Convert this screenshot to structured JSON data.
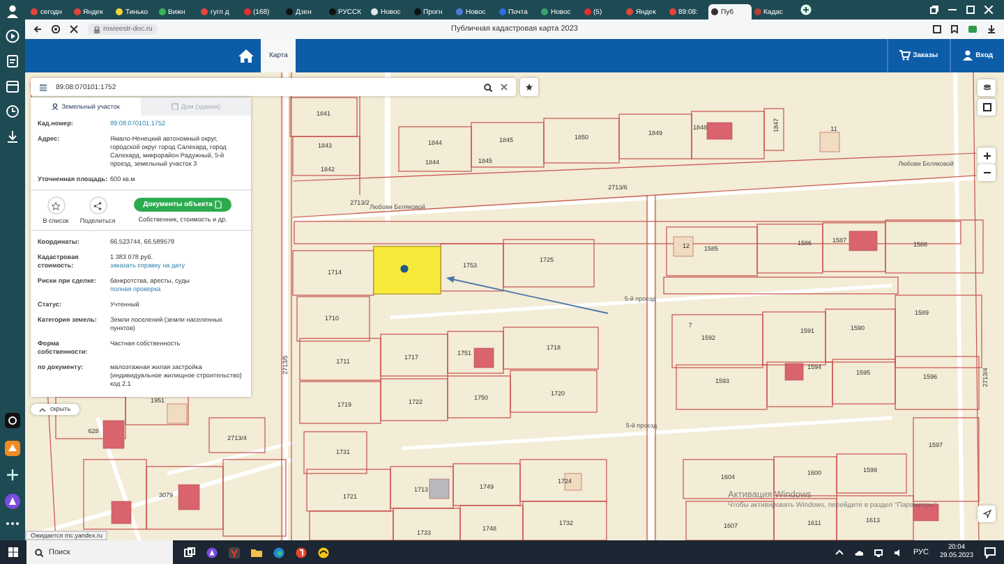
{
  "browser": {
    "tabs": [
      {
        "title": "сегодн",
        "color": "#e4453a",
        "selected": false
      },
      {
        "title": "Яндек",
        "color": "#e4453a",
        "selected": false
      },
      {
        "title": "Тинько",
        "color": "#f5d33c",
        "selected": false
      },
      {
        "title": "Вижн",
        "color": "#3bb35a",
        "selected": false
      },
      {
        "title": "гугл д",
        "color": "#e4453a",
        "selected": false
      },
      {
        "title": "(168)",
        "color": "#e03030",
        "selected": false
      },
      {
        "title": "Дзен",
        "color": "#111111",
        "selected": false
      },
      {
        "title": "РУССК",
        "color": "#111111",
        "selected": false
      },
      {
        "title": "Новос",
        "color": "#dfe8ea",
        "selected": false
      },
      {
        "title": "Прогн",
        "color": "#111111",
        "selected": false
      },
      {
        "title": "Новос",
        "color": "#4b7bd8",
        "selected": false
      },
      {
        "title": "Почта",
        "color": "#2f6fe0",
        "selected": false
      },
      {
        "title": "Новос",
        "color": "#3aa36a",
        "selected": false
      },
      {
        "title": "(5)",
        "color": "#e03030",
        "selected": false
      },
      {
        "title": "Яндек",
        "color": "#e4453a",
        "selected": false
      },
      {
        "title": "89:08:",
        "color": "#e4453a",
        "selected": false
      },
      {
        "title": "Пуб",
        "color": "#333333",
        "selected": true
      },
      {
        "title": "Кадас",
        "color": "#b5412e",
        "selected": false
      }
    ],
    "address": "rosreestr-doc.ru",
    "page_title": "Публичная кадастровая карта 2023",
    "status": "Ожидается mc.yandex.ru"
  },
  "site_header": {
    "nav": [
      {
        "label": "Карта",
        "selected": true
      }
    ],
    "actions": [
      "Заказы",
      "Вход"
    ]
  },
  "search": {
    "value": "89:08:070101:1752"
  },
  "panel": {
    "tabs": [
      {
        "label": "Земельный участок",
        "selected": true
      },
      {
        "label": "Дом (здания)",
        "selected": false
      }
    ],
    "fields": [
      {
        "label": "Кад.номер:",
        "value": "89:08:070101:1752",
        "kind": "link"
      },
      {
        "label": "Адрес:",
        "value": "Ямало-Ненецкий автономный округ, городской округ город Салехард, город Салехард, микрорайон Радужный, 5-й проезд, земельный участок 3",
        "kind": "text"
      },
      {
        "label": "Уточненная площадь:",
        "value": "600 кв.м",
        "kind": "text"
      }
    ],
    "actions": [
      {
        "label": "В список",
        "kind": "star"
      },
      {
        "label": "Поделиться",
        "kind": "share"
      }
    ],
    "documents_button": "Документы объекта",
    "documents_caption": "Собственник, стоимость и др.",
    "details": [
      {
        "label": "Координаты:",
        "value": "66.523744, 66.589579"
      },
      {
        "label": "Кадастровая стоимость:",
        "value": "1 383 078 руб.",
        "link": "заказать справку на дату"
      },
      {
        "label": "Риски при сделке:",
        "value": "банкротства, аресты, суды",
        "link": "полная проверка"
      },
      {
        "label": "Статус:",
        "value": "Учтенный"
      },
      {
        "label": "Категория земель:",
        "value": "Земли поселений (земли населенных пунктов)"
      },
      {
        "label": "Форма собственности:",
        "value": "Частная собственность"
      },
      {
        "label": "по документу:",
        "value": "малоэтажная жилая застройка (индивидуальное жилищное строительство) код 2.1"
      }
    ],
    "hide_button": "скрыть"
  },
  "map": {
    "labels": [
      {
        "text": "1841",
        "kind": "parcel"
      },
      {
        "text": "1843",
        "kind": "parcel"
      },
      {
        "text": "1842",
        "kind": "parcel"
      },
      {
        "text": "1844",
        "kind": "parcel"
      },
      {
        "text": "1844",
        "kind": "parcel"
      },
      {
        "text": "1845",
        "kind": "parcel"
      },
      {
        "text": "1845",
        "kind": "parcel"
      },
      {
        "text": "1850",
        "kind": "parcel"
      },
      {
        "text": "1849",
        "kind": "parcel"
      },
      {
        "text": "1848",
        "kind": "parcel"
      },
      {
        "text": "1847",
        "kind": "vertical"
      },
      {
        "text": "11",
        "kind": "parcel"
      },
      {
        "text": "2713/6",
        "kind": "parcel"
      },
      {
        "text": "2713/2",
        "kind": "parcel"
      },
      {
        "text": "Любови Беляковой",
        "kind": "street"
      },
      {
        "text": "Любови Беляковой",
        "kind": "street"
      },
      {
        "text": "2713/5",
        "kind": "vertical"
      },
      {
        "text": "1714",
        "kind": "parcel"
      },
      {
        "text": "1753",
        "kind": "parcel"
      },
      {
        "text": "1725",
        "kind": "parcel"
      },
      {
        "text": "1710",
        "kind": "parcel"
      },
      {
        "text": "5-й проезд",
        "kind": "street"
      },
      {
        "text": "1711",
        "kind": "parcel"
      },
      {
        "text": "1717",
        "kind": "parcel"
      },
      {
        "text": "1751",
        "kind": "parcel"
      },
      {
        "text": "1718",
        "kind": "parcel"
      },
      {
        "text": "1719",
        "kind": "parcel"
      },
      {
        "text": "1722",
        "kind": "parcel"
      },
      {
        "text": "1750",
        "kind": "parcel"
      },
      {
        "text": "1720",
        "kind": "parcel"
      },
      {
        "text": "1731",
        "kind": "parcel"
      },
      {
        "text": "1721",
        "kind": "parcel"
      },
      {
        "text": "1713",
        "kind": "parcel"
      },
      {
        "text": "1749",
        "kind": "parcel"
      },
      {
        "text": "1724",
        "kind": "parcel"
      },
      {
        "text": "1733",
        "kind": "parcel"
      },
      {
        "text": "1748",
        "kind": "parcel"
      },
      {
        "text": "1732",
        "kind": "parcel"
      },
      {
        "text": "12",
        "kind": "parcel"
      },
      {
        "text": "1585",
        "kind": "parcel"
      },
      {
        "text": "1586",
        "kind": "parcel"
      },
      {
        "text": "1587",
        "kind": "parcel"
      },
      {
        "text": "1588",
        "kind": "parcel"
      },
      {
        "text": "1589",
        "kind": "parcel"
      },
      {
        "text": "7",
        "kind": "parcel"
      },
      {
        "text": "1592",
        "kind": "parcel"
      },
      {
        "text": "1591",
        "kind": "parcel"
      },
      {
        "text": "1590",
        "kind": "parcel"
      },
      {
        "text": "5-й проезд",
        "kind": "street"
      },
      {
        "text": "1593",
        "kind": "parcel"
      },
      {
        "text": "1594",
        "kind": "parcel"
      },
      {
        "text": "1595",
        "kind": "parcel"
      },
      {
        "text": "1596",
        "kind": "parcel"
      },
      {
        "text": "1597",
        "kind": "parcel"
      },
      {
        "text": "2713/4",
        "kind": "vertical"
      },
      {
        "text": "1604",
        "kind": "parcel"
      },
      {
        "text": "1600",
        "kind": "parcel"
      },
      {
        "text": "1599",
        "kind": "parcel"
      },
      {
        "text": "1607",
        "kind": "parcel"
      },
      {
        "text": "1611",
        "kind": "parcel"
      },
      {
        "text": "1613",
        "kind": "parcel"
      },
      {
        "text": "1951",
        "kind": "parcel"
      },
      {
        "text": "628",
        "kind": "parcel"
      },
      {
        "text": "2713/4",
        "kind": "parcel"
      },
      {
        "text": "3079",
        "kind": "parcel"
      }
    ]
  },
  "windows_notice": {
    "title": "Активация Windows",
    "text": "Чтобы активировать Windows, перейдите в раздел \"Параметры\"."
  },
  "taskbar": {
    "search_placeholder": "Поиск",
    "language": "РУС",
    "time": "20:04",
    "date": "29.05.2023"
  }
}
